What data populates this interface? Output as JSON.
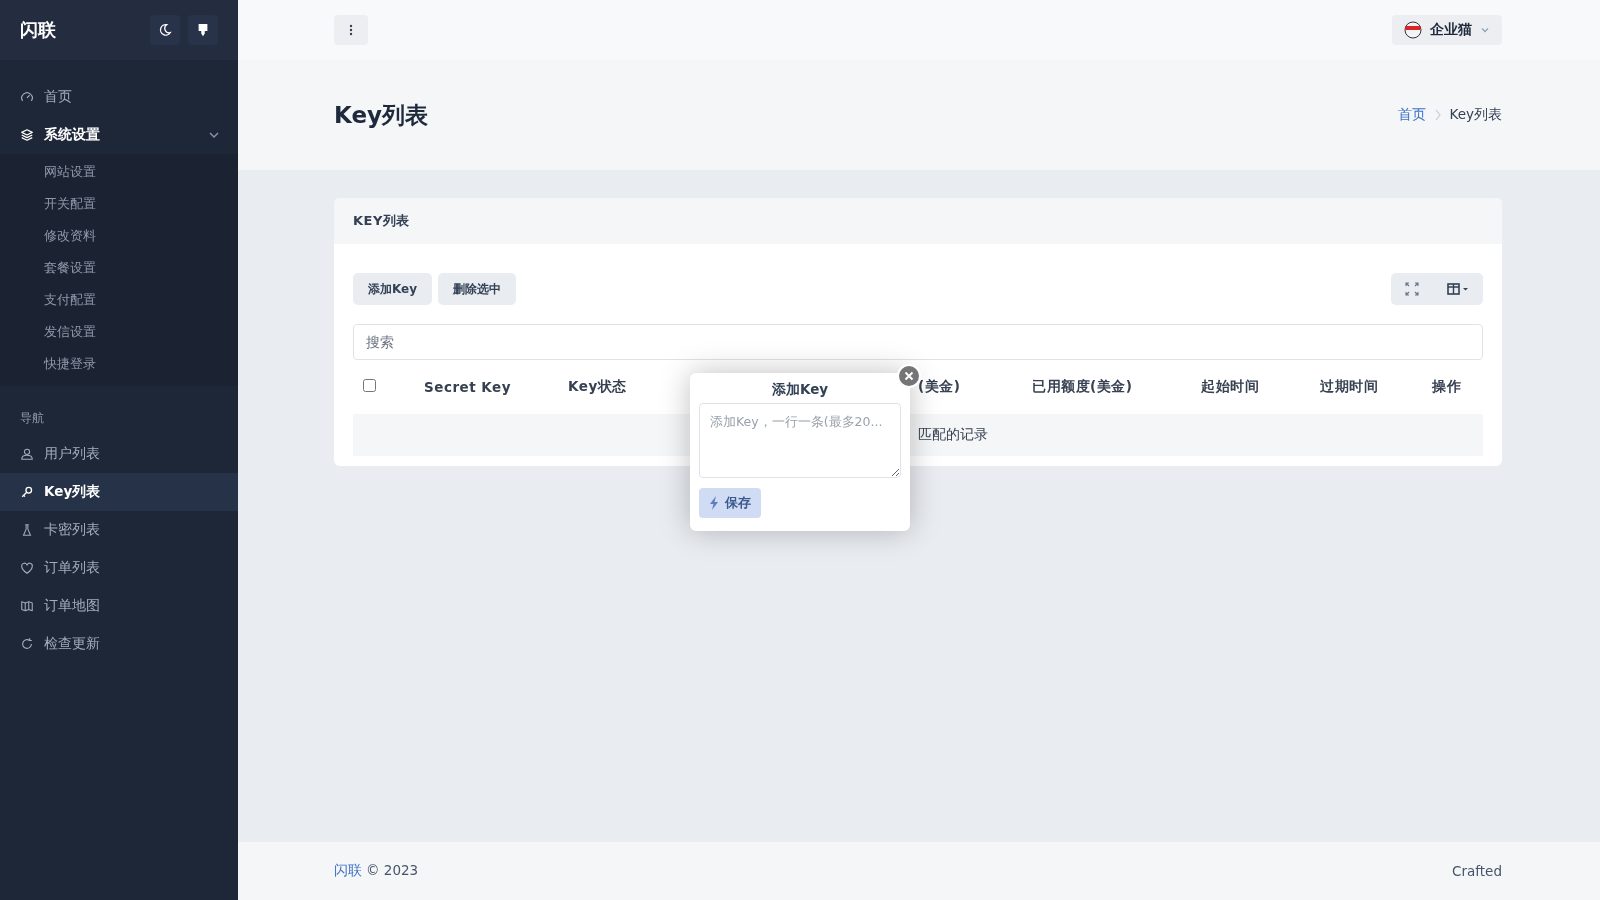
{
  "sidebar": {
    "brand": "闪联",
    "groups": [
      {
        "items": [
          {
            "label": "首页",
            "kind": "gauge",
            "selected": false
          },
          {
            "label": "系统设置",
            "kind": "layers",
            "selected": false,
            "expanded": true,
            "children": [
              {
                "label": "网站设置",
                "selected": false
              },
              {
                "label": "开关配置",
                "selected": false
              },
              {
                "label": "修改资料",
                "selected": false
              },
              {
                "label": "套餐设置",
                "selected": false
              },
              {
                "label": "支付配置",
                "selected": false
              },
              {
                "label": "发信设置",
                "selected": false
              },
              {
                "label": "快捷登录",
                "selected": false
              }
            ]
          }
        ]
      },
      {
        "heading": "导航",
        "items": [
          {
            "label": "用户列表",
            "kind": "user",
            "selected": false
          },
          {
            "label": "Key列表",
            "kind": "key",
            "selected": true
          },
          {
            "label": "卡密列表",
            "kind": "tube",
            "selected": false
          },
          {
            "label": "订单列表",
            "kind": "heart",
            "selected": false
          },
          {
            "label": "订单地图",
            "kind": "map",
            "selected": false
          },
          {
            "label": "检查更新",
            "kind": "refresh",
            "selected": false
          }
        ]
      }
    ]
  },
  "topbar": {
    "user": "企业猫"
  },
  "page": {
    "title": "Key列表",
    "breadcrumb": [
      {
        "label": "首页",
        "link": true
      },
      {
        "label": "Key列表",
        "link": false
      }
    ]
  },
  "card": {
    "title": "KEY列表",
    "buttons": [
      "添加Key",
      "删除选中"
    ],
    "search": {
      "placeholder": "搜索"
    },
    "table": {
      "select_all": {
        "checked": false
      },
      "columns": [
        "Secret Key",
        "Key状态",
        "(美金)",
        "已用额度(美金)",
        "起始时间",
        "过期时间",
        "操作"
      ],
      "empty_text": "匹配的记录"
    }
  },
  "popup": {
    "title": "添加Key",
    "placeholder": "添加Key，一行一条(最多20...",
    "button": "保存"
  },
  "footer": {
    "brand": "闪联",
    "copyright": "© 2023",
    "credit": "Crafted"
  }
}
